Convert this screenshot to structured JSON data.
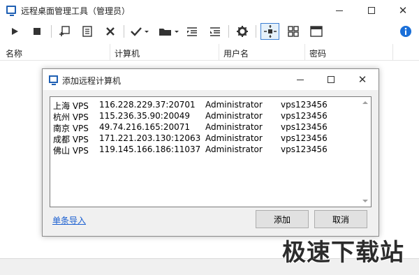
{
  "window": {
    "title": "远程桌面管理工具（管理员）",
    "min_label": "—",
    "close_label": "✕"
  },
  "toolbar": {
    "items": [
      {
        "icon": "play-icon"
      },
      {
        "icon": "stop-icon"
      },
      {
        "icon": "add-computer-icon"
      },
      {
        "icon": "edit-document-icon"
      },
      {
        "icon": "delete-icon"
      },
      {
        "icon": "check-dropdown-icon"
      },
      {
        "icon": "folder-dropdown-icon"
      },
      {
        "icon": "indent-up-icon"
      },
      {
        "icon": "indent-down-icon"
      },
      {
        "icon": "gear-icon"
      },
      {
        "icon": "fit-screen-icon"
      },
      {
        "icon": "grid-view-icon"
      },
      {
        "icon": "window-icon"
      },
      {
        "icon": "info-icon"
      }
    ]
  },
  "list": {
    "columns": [
      "名称",
      "计算机",
      "用户名",
      "密码"
    ]
  },
  "dialog": {
    "title": "添加远程计算机",
    "rows": [
      {
        "city": "上海 VPS",
        "ip": "116.228.229.37:20701",
        "user": "Administrator",
        "pass": "vps123456"
      },
      {
        "city": "杭州 VPS",
        "ip": "115.236.35.90:20049",
        "user": "Administrator",
        "pass": "vps123456"
      },
      {
        "city": "南京 VPS",
        "ip": "49.74.216.165:20071",
        "user": "Administrator",
        "pass": "vps123456"
      },
      {
        "city": "成都 VPS",
        "ip": "171.221.203.130:12063",
        "user": "Administrator",
        "pass": "vps123456"
      },
      {
        "city": "佛山 VPS",
        "ip": "119.145.166.186:11037",
        "user": "Administrator",
        "pass": "vps123456"
      }
    ],
    "link_label": "单条导入",
    "add_label": "添加",
    "cancel_label": "取消"
  },
  "watermark": "极速下载站",
  "colors": {
    "accent": "#1e5fb3",
    "link": "#1a5fd1",
    "info": "#1a6fd8"
  }
}
